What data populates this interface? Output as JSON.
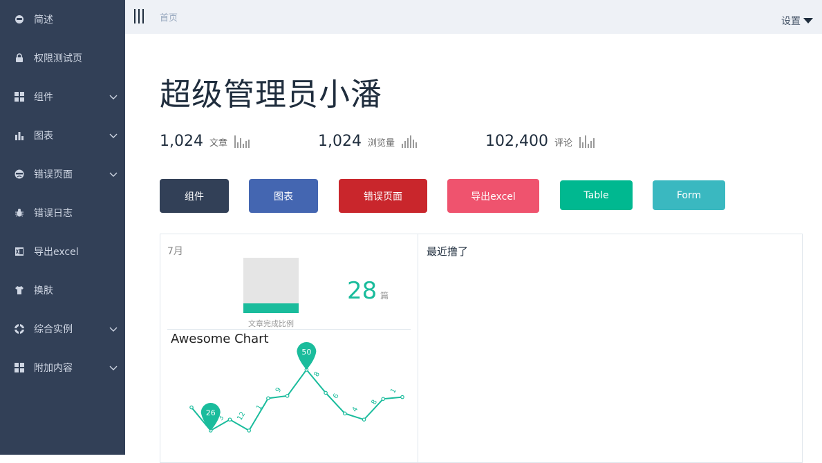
{
  "sidebar": {
    "items": [
      {
        "label": "简述",
        "icon": "face-icon",
        "has_submenu": false
      },
      {
        "label": "权限测试页",
        "icon": "lock-icon",
        "has_submenu": false
      },
      {
        "label": "组件",
        "icon": "grid-icon",
        "has_submenu": true
      },
      {
        "label": "图表",
        "icon": "bar-chart-icon",
        "has_submenu": true
      },
      {
        "label": "错误页面",
        "icon": "sad-face-icon",
        "has_submenu": true
      },
      {
        "label": "错误日志",
        "icon": "bug-icon",
        "has_submenu": false
      },
      {
        "label": "导出excel",
        "icon": "excel-icon",
        "has_submenu": false
      },
      {
        "label": "换肤",
        "icon": "shirt-icon",
        "has_submenu": false
      },
      {
        "label": "综合实例",
        "icon": "lifebuoy-icon",
        "has_submenu": true
      },
      {
        "label": "附加内容",
        "icon": "grid-icon",
        "has_submenu": true
      }
    ]
  },
  "topbar": {
    "breadcrumb": "首页",
    "settings_label": "设置"
  },
  "main": {
    "title": "超级管理员小潘",
    "stats": [
      {
        "value": "1,024",
        "label": "文章"
      },
      {
        "value": "1,024",
        "label": "浏览量"
      },
      {
        "value": "102,400",
        "label": "评论"
      }
    ],
    "buttons": [
      {
        "label": "组件",
        "color": "#324057"
      },
      {
        "label": "图表",
        "color": "#4466b1"
      },
      {
        "label": "错误页面",
        "color": "#c9262c"
      },
      {
        "label": "导出excel",
        "color": "#ef536e"
      },
      {
        "label": "Table",
        "color": "#00b890"
      },
      {
        "label": "Form",
        "color": "#3ab8c0"
      }
    ]
  },
  "summary_panel": {
    "month": "7月",
    "completion_ratio": 0.18,
    "completion_caption": "文章完成比例",
    "count": "28",
    "count_unit": "篇"
  },
  "recent_panel": {
    "title": "最近撸了"
  },
  "chart_data": {
    "type": "line",
    "title": "Awesome Chart",
    "xlabel": "",
    "ylabel": "",
    "values": [
      1,
      26,
      3,
      12,
      1,
      9,
      50,
      8,
      6,
      4,
      8,
      1
    ],
    "max_label": "50",
    "min_label": "26",
    "color": "#1abc9c"
  }
}
